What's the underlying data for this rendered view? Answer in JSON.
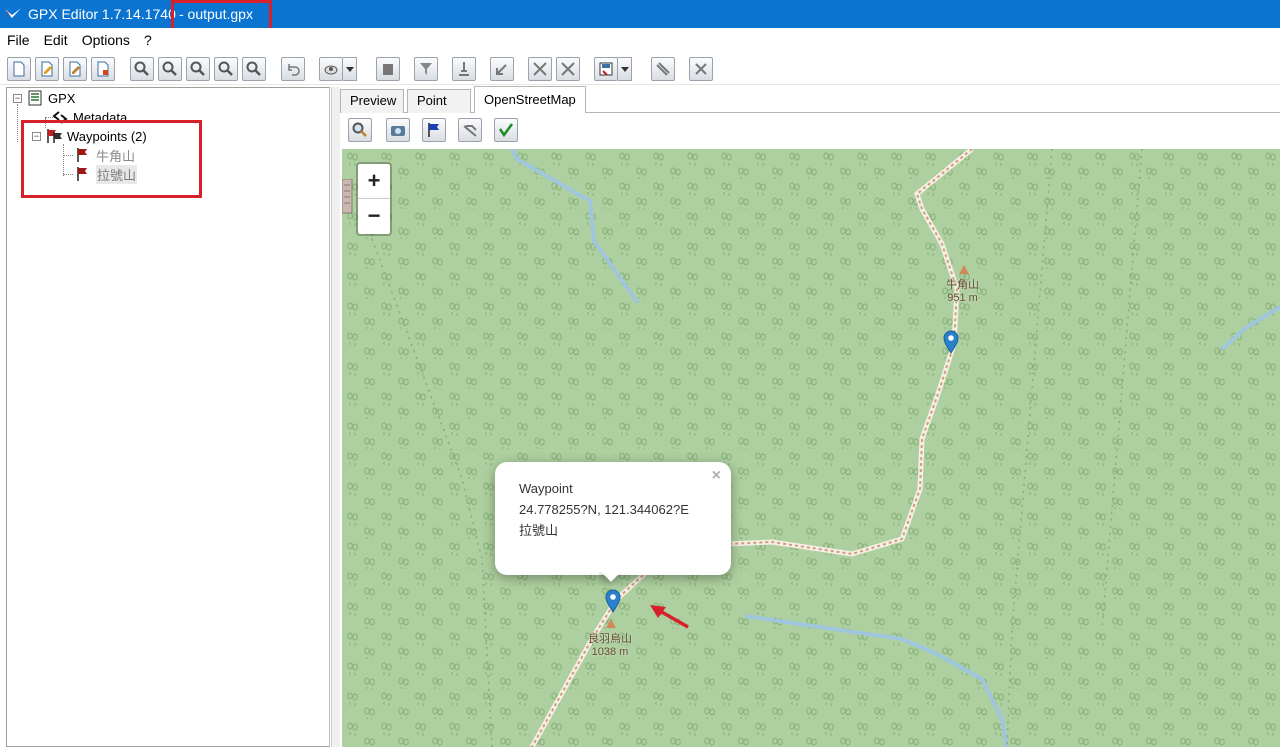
{
  "window": {
    "title": "GPX Editor 1.7.14.1740",
    "file": "- output.gpx"
  },
  "menu": [
    "File",
    "Edit",
    "Options",
    "?"
  ],
  "tree": {
    "root": "GPX",
    "metadata": "Metadata",
    "waypoints_group": "Waypoints (2)",
    "waypoints": [
      "牛角山",
      "拉號山"
    ]
  },
  "tabs": [
    {
      "label": "Preview",
      "active": false
    },
    {
      "label": "Point list",
      "active": false
    },
    {
      "label": "OpenStreetMap",
      "active": true
    }
  ],
  "map": {
    "zoom_in": "+",
    "zoom_out": "−",
    "peaks": [
      {
        "name": "牛角山",
        "elevation": "951 m"
      },
      {
        "name": "良羽烏山",
        "elevation": "1038 m"
      }
    ],
    "popup": {
      "title": "Waypoint",
      "coords": "24.778255?N, 121.344062?E",
      "name": "拉號山",
      "close": "×"
    }
  },
  "colors": {
    "titlebar": "#0b74d1",
    "map_forest": "#aed0a0",
    "highlight": "#d8202a",
    "pin": "#2a81cb"
  }
}
